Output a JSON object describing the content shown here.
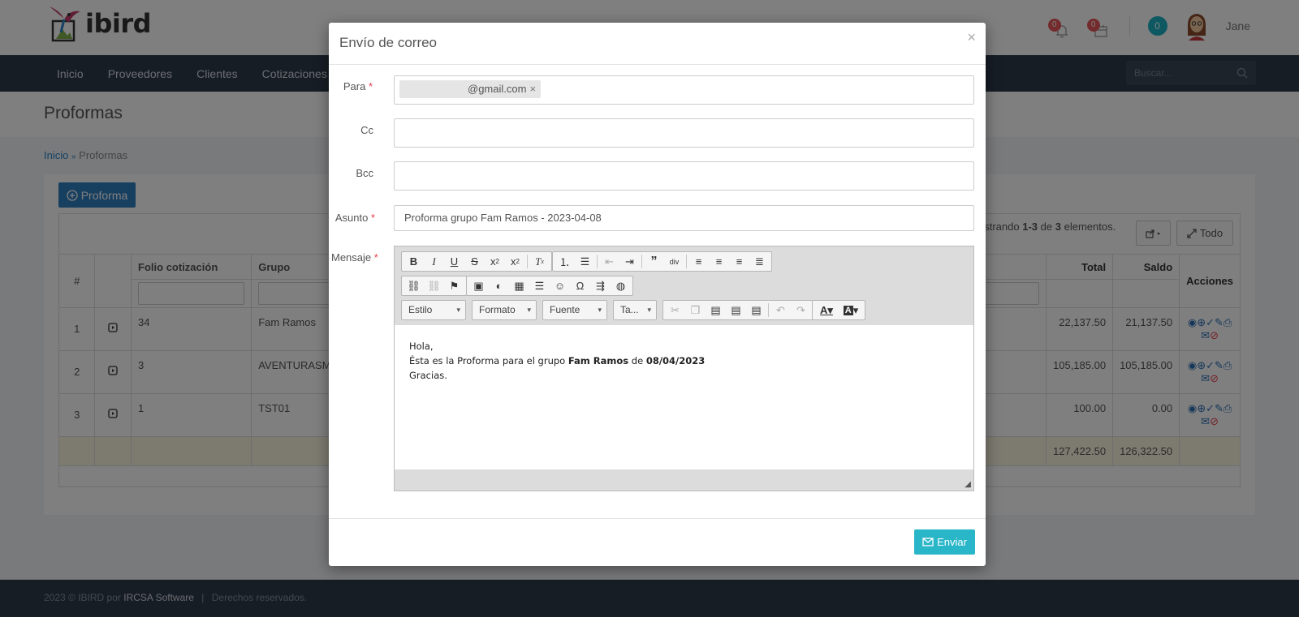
{
  "app": {
    "logo_text": "ibird",
    "user_name": "Jane",
    "notif_count": "0",
    "calendar_count": "0",
    "teal_count": "0"
  },
  "nav": {
    "items": [
      "Inicio",
      "Proveedores",
      "Clientes",
      "Cotizaciones"
    ],
    "search_placeholder": "Buscar..."
  },
  "page": {
    "title": "Proformas",
    "breadcrumb_home": "Inicio",
    "breadcrumb_sep": "»",
    "breadcrumb_current": "Proformas",
    "add_button": "Proforma"
  },
  "table": {
    "showing_prefix": "ostrando",
    "showing_range": "1-3",
    "showing_de": "de",
    "showing_total": "3",
    "showing_suffix": "elementos.",
    "todo_button": "Todo",
    "headers": {
      "num": "#",
      "folio": "Folio cotización",
      "grupo": "Grupo",
      "total": "Total",
      "saldo": "Saldo",
      "acciones": "Acciones"
    },
    "rows": [
      {
        "num": "1",
        "folio": "34",
        "grupo": "Fam Ramos",
        "total": "22,137.50",
        "saldo": "21,137.50"
      },
      {
        "num": "2",
        "folio": "3",
        "grupo": "AVENTURASMX",
        "total": "105,185.00",
        "saldo": "105,185.00"
      },
      {
        "num": "3",
        "folio": "1",
        "grupo": "TST01",
        "total": "100.00",
        "saldo": "0.00"
      }
    ],
    "totals": {
      "total": "127,422.50",
      "saldo": "126,322.50"
    }
  },
  "footer": {
    "prefix": "2023 © IBIRD por",
    "brand": "IRCSA Software",
    "sep": "|",
    "rights": "Derechos reservados."
  },
  "modal": {
    "title": "Envío de correo",
    "close": "×",
    "labels": {
      "para": "Para",
      "cc": "Cc",
      "bcc": "Bcc",
      "asunto": "Asunto",
      "mensaje": "Mensaje",
      "required_mark": "*"
    },
    "to_chip": "@gmail.com",
    "chip_remove": "×",
    "cc_value": "",
    "bcc_value": "",
    "subject": "Proforma grupo Fam Ramos - 2023-04-08",
    "editor": {
      "combos": {
        "estilo": "Estilo",
        "formato": "Formato",
        "fuente": "Fuente",
        "tamano": "Ta..."
      },
      "body": {
        "line1": "Hola,",
        "line2_a": "Ésta es la Proforma para el grupo ",
        "line2_b": "Fam Ramos",
        "line2_c": " de ",
        "line2_d": "08/04/2023",
        "line3": "Gracias."
      }
    },
    "send_button": "Enviar"
  }
}
